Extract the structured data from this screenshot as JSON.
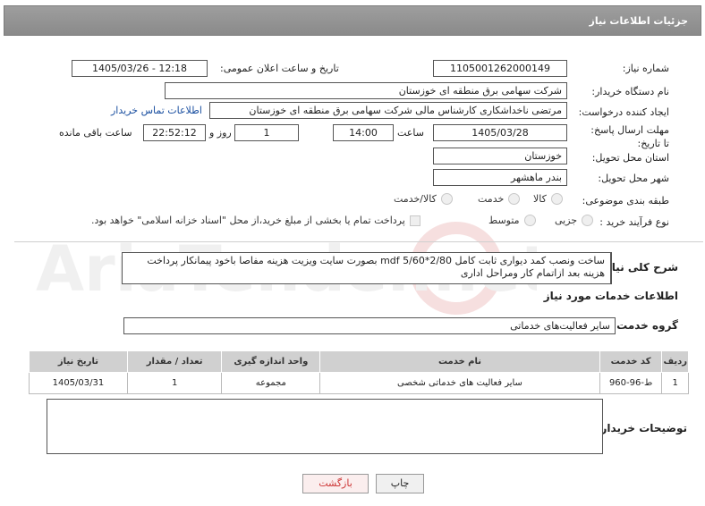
{
  "header": {
    "title": "جزئیات اطلاعات نیاز"
  },
  "form": {
    "need_number_label": "شماره نیاز:",
    "need_number": "1105001262000149",
    "announce_label": "تاریخ و ساعت اعلان عمومی:",
    "announce_value": "1405/03/26 - 12:18",
    "buyer_org_label": "نام دستگاه خریدار:",
    "buyer_org": "شرکت سهامی برق منطقه ای خوزستان",
    "creator_label": "ایجاد کننده درخواست:",
    "creator": "مرتضی ناخداشکاری کارشناس مالی شرکت سهامی برق منطقه ای خوزستان",
    "contact_link": "اطلاعات تماس خریدار",
    "deadline_label": "مهلت ارسال پاسخ: تا تاریخ:",
    "deadline_date": "1405/03/28",
    "time_label": "ساعت",
    "deadline_time": "14:00",
    "days": "1",
    "days_label": "روز و",
    "remaining_time": "22:52:12",
    "remaining_label": "ساعت باقی مانده",
    "province_label": "استان محل تحویل:",
    "province": "خوزستان",
    "city_label": "شهر محل تحویل:",
    "city": "بندر ماهشهر",
    "category_label": "طبقه بندی موضوعی:",
    "category_options": [
      "کالا",
      "خدمت",
      "کالا/خدمت"
    ],
    "process_label": "نوع فرآیند خرید :",
    "process_options": [
      "جزیی",
      "متوسط"
    ],
    "payment_note": "پرداخت تمام یا بخشی از مبلغ خرید،از محل \"اسناد خزانه اسلامی\" خواهد بود."
  },
  "description": {
    "label": "شرح کلی نیاز:",
    "text": "ساخت ونصب کمد دیواری ثابت کامل mdf 5/60*2/80 بصورت سایت ویزیت هزینه مفاصا باخود پیمانکار پرداخت هزینه بعد ازاتمام کار ومراحل اداری"
  },
  "services": {
    "section_title": "اطلاعات خدمات مورد نیاز",
    "group_label": "گروه خدمت:",
    "group_value": "سایر فعالیت‌های خدماتی",
    "columns": [
      "ردیف",
      "کد خدمت",
      "نام خدمت",
      "واحد اندازه گیری",
      "تعداد / مقدار",
      "تاریخ نیاز"
    ],
    "rows": [
      [
        "1",
        "ط-96-960",
        "سایر فعالیت های خدماتی شخصی",
        "مجموعه",
        "1",
        "1405/03/31"
      ]
    ]
  },
  "buyer_notes": {
    "label": "توضیحات خریدار:",
    "value": ""
  },
  "buttons": {
    "print": "چاپ",
    "back": "بازگشت"
  },
  "watermark": {
    "text": "AriaTender.net"
  }
}
